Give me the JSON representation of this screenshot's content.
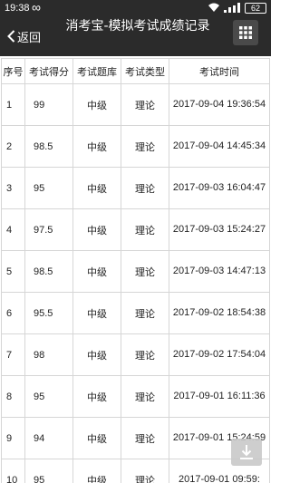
{
  "status_bar": {
    "time": "19:38",
    "infinity": "∞",
    "battery": "62"
  },
  "header": {
    "back_label": "返回",
    "title": "消考宝-模拟考试成绩记录"
  },
  "table": {
    "columns": [
      "序号",
      "考试得分",
      "考试题库",
      "考试类型",
      "考试时间"
    ],
    "rows": [
      [
        "1",
        "99",
        "中级",
        "理论",
        "2017-09-04 19:36:54"
      ],
      [
        "2",
        "98.5",
        "中级",
        "理论",
        "2017-09-04 14:45:34"
      ],
      [
        "3",
        "95",
        "中级",
        "理论",
        "2017-09-03 16:04:47"
      ],
      [
        "4",
        "97.5",
        "中级",
        "理论",
        "2017-09-03 15:24:27"
      ],
      [
        "5",
        "98.5",
        "中级",
        "理论",
        "2017-09-03 14:47:13"
      ],
      [
        "6",
        "95.5",
        "中级",
        "理论",
        "2017-09-02 18:54:38"
      ],
      [
        "7",
        "98",
        "中级",
        "理论",
        "2017-09-02 17:54:04"
      ],
      [
        "8",
        "95",
        "中级",
        "理论",
        "2017-09-01 16:11:36"
      ],
      [
        "9",
        "94",
        "中级",
        "理论",
        "2017-09-01 15:24:59"
      ],
      [
        "10",
        "95",
        "中级",
        "理论",
        "2017-09-01 09:59:"
      ]
    ]
  },
  "colors": {
    "header_bg": "#2b2b2b",
    "border": "#d6d6d6"
  },
  "icons": {
    "back": "chevron-left-icon",
    "menu": "grid-icon",
    "download": "download-icon"
  }
}
